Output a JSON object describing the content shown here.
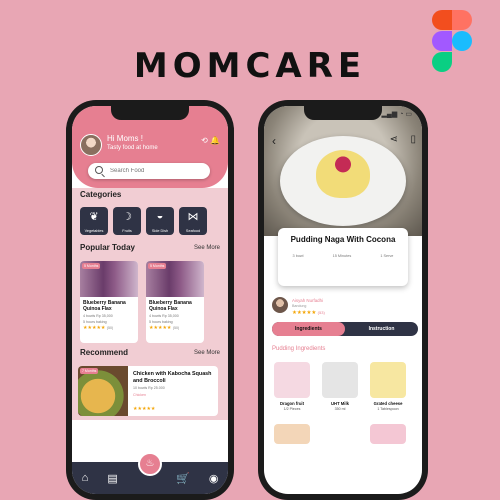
{
  "brand": {
    "title": "MOMCARE"
  },
  "home": {
    "greeting": "Hi Moms !",
    "tagline": "Tasty food at home",
    "search_placeholder": "Search Food",
    "categories_title": "Categories",
    "categories": [
      {
        "label": "Vegetables",
        "icon": "broccoli-icon"
      },
      {
        "label": "Fruits",
        "icon": "banana-icon"
      },
      {
        "label": "Side Dish",
        "icon": "bowl-icon"
      },
      {
        "label": "Seafood",
        "icon": "fish-icon"
      }
    ],
    "popular_title": "Popular Today",
    "popular_see_more": "See More",
    "popular_items": [
      {
        "badge": "5 Months",
        "title": "Blueberry Banana Quinoa Flax",
        "meta": "4 bowls   Rp 35,000",
        "sub": "5 hours baking",
        "stars": "★★★★★",
        "rating": "(50)"
      },
      {
        "badge": "5 Months",
        "title": "Blueberry Banana Quinoa Flax",
        "meta": "4 bowls   Rp 35,000",
        "sub": "5 hours baking",
        "stars": "★★★★★",
        "rating": "(50)"
      }
    ],
    "recommend_title": "Recommend",
    "recommend_see_more": "See More",
    "recommend_item": {
      "badge": "7 Months",
      "title": "Chicken with Kabocha Squash and Broccoli",
      "meta": "10 bowls   Rp 25.000",
      "sub": "Chicken",
      "stars": "★★★★★"
    },
    "nav": [
      {
        "icon": "home-icon",
        "glyph": "⌂"
      },
      {
        "icon": "book-icon",
        "glyph": "▤"
      },
      {
        "icon": "cart-icon",
        "glyph": "🛒"
      },
      {
        "icon": "profile-icon",
        "glyph": "◉"
      }
    ]
  },
  "detail": {
    "status_icons": "▂▄▆ ◔ ▭",
    "title": "Pudding Naga With Cocona",
    "meta": [
      "3 bowl",
      "15 Minutes",
      "1 Serve"
    ],
    "author_name": "Aisyah Nurfadhi",
    "author_role": "Bandung",
    "author_stars": "★★★★★",
    "author_rating": "(53)",
    "tabs": [
      "Ingredients",
      "Instruction"
    ],
    "ingredients_title": "Pudding Ingredients",
    "ingredients": [
      {
        "name": "Dragon fruit",
        "qty": "1/2 Pieces",
        "color": "#f5d9e2"
      },
      {
        "name": "UHT Milk",
        "qty": "350 ml",
        "color": "#e5e5e5"
      },
      {
        "name": "Grated cheese",
        "qty": "1 Tablespoon",
        "color": "#f7e7a1"
      }
    ]
  },
  "colors": {
    "accent": "#e67f91",
    "dark": "#2f3345",
    "background": "#e8a6b4"
  }
}
